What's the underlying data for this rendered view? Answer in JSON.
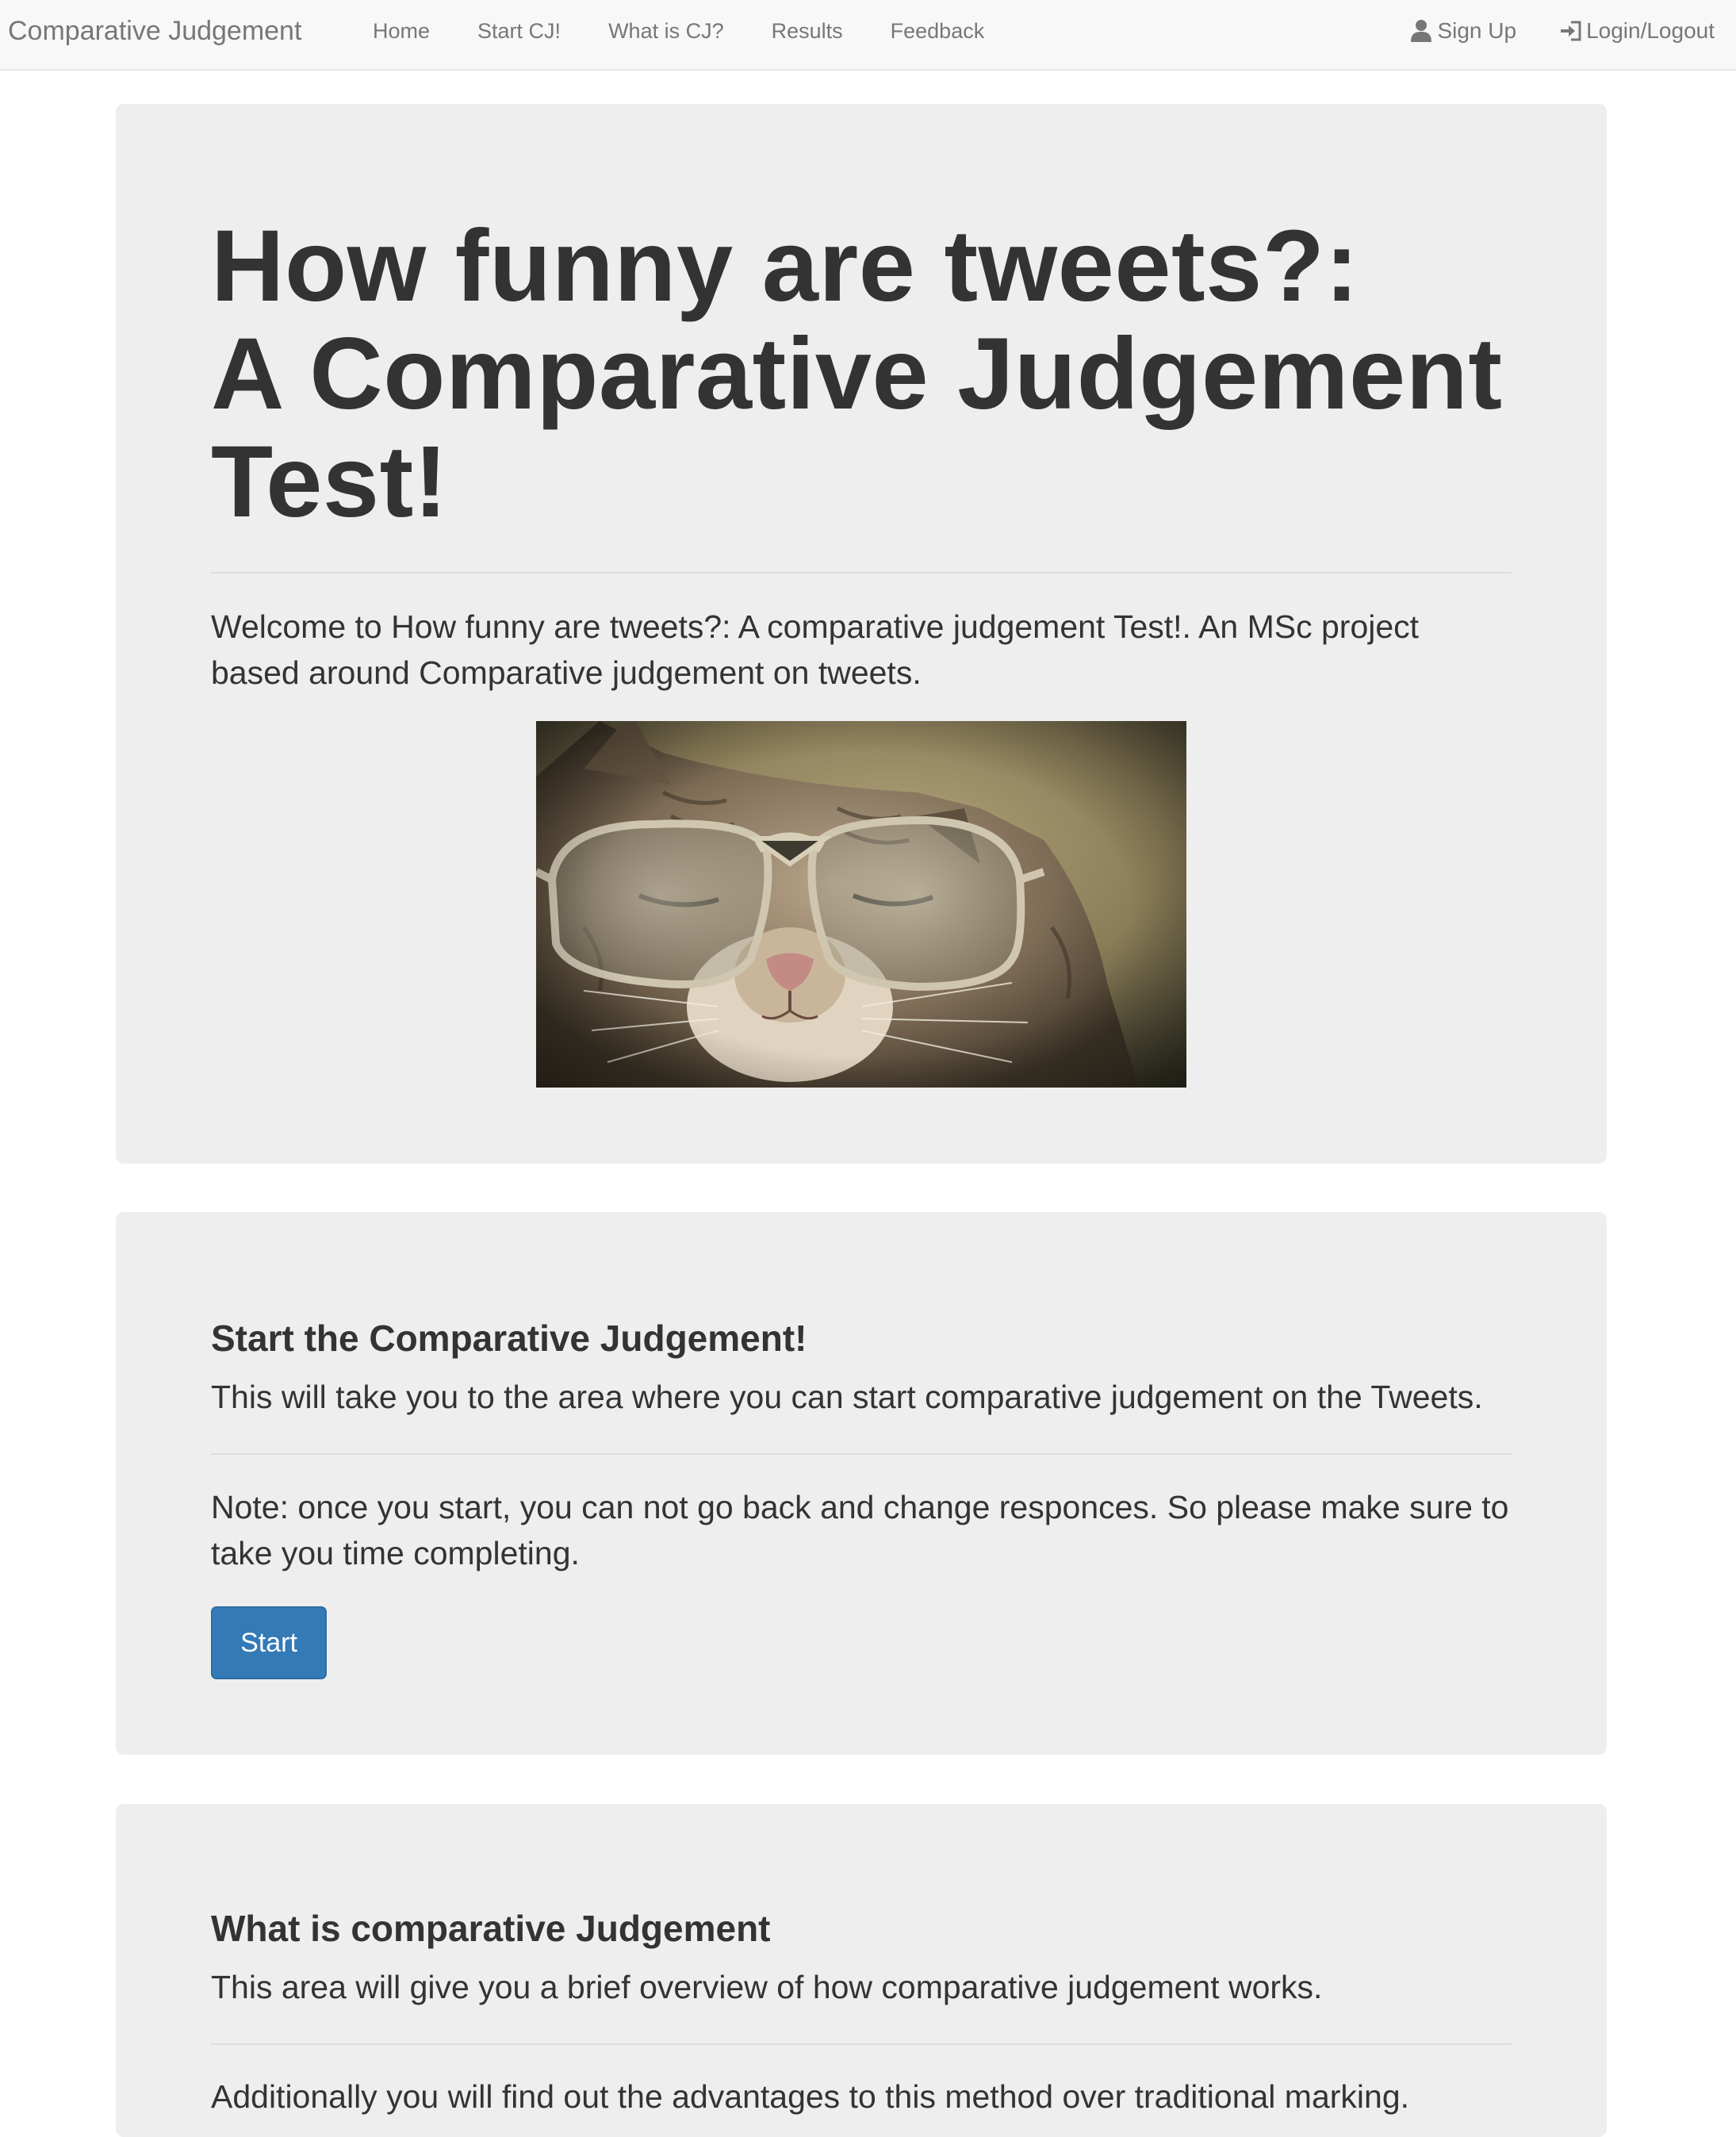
{
  "navbar": {
    "brand": "Comparative Judgement",
    "links": [
      "Home",
      "Start CJ!",
      "What is CJ?",
      "Results",
      "Feedback"
    ],
    "right_links": [
      {
        "label": "Sign Up",
        "icon": "user-icon"
      },
      {
        "label": "Login/Logout",
        "icon": "login-icon"
      }
    ]
  },
  "hero": {
    "title_line1": "How funny are tweets?:",
    "title_line2": "A Comparative Judgement",
    "title_line3": "Test!",
    "lead": "Welcome to How funny are tweets?: A comparative judgement Test!. An MSc project based around Comparative judgement on tweets.",
    "image": "cat-wearing-glasses-image"
  },
  "start_section": {
    "heading": "Start the Comparative Judgement!",
    "description": "This will take you to the area where you can start comparative judgement on the Tweets.",
    "note": "Note: once you start, you can not go back and change responces. So please make sure to take you time completing.",
    "button_label": "Start"
  },
  "what_section": {
    "heading": "What is comparative Judgement",
    "description": "This area will give you a brief overview of how comparative judgement works.",
    "extra": "Additionally you will find out the advantages to this method over traditional marking."
  },
  "colors": {
    "navbar_bg": "#f8f8f8",
    "panel_bg": "#eeeeee",
    "primary_button": "#337ab7",
    "text": "#333333",
    "nav_text": "#777777"
  }
}
